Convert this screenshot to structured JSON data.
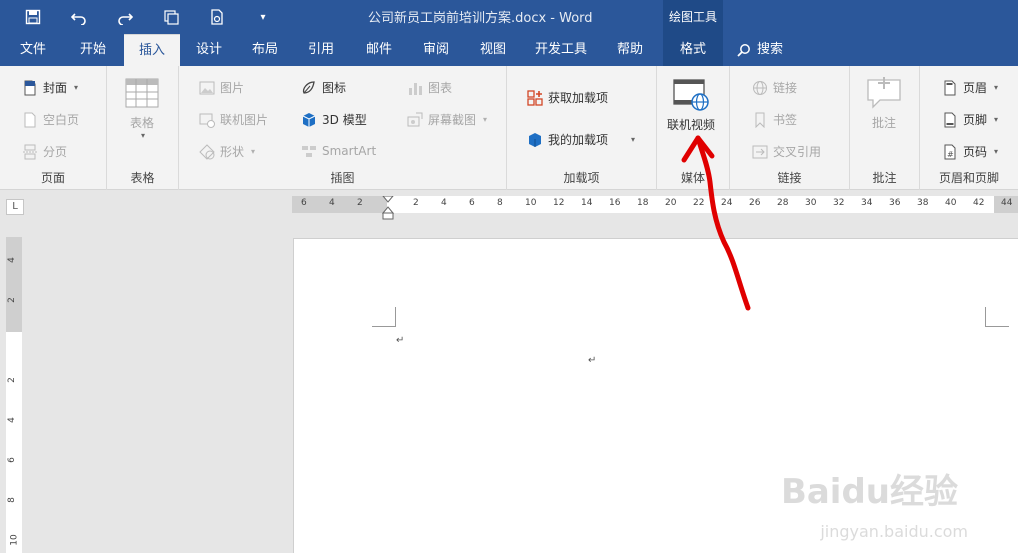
{
  "title_bar": {
    "document_title": "公司新员工岗前培训方案.docx - Word",
    "context_tab_group": "绘图工具",
    "quick_access": [
      "save-icon",
      "undo-icon",
      "redo-icon",
      "touch-mode-icon",
      "print-preview-icon",
      "customize-qat-icon"
    ]
  },
  "tabs": [
    {
      "label": "文件"
    },
    {
      "label": "开始"
    },
    {
      "label": "插入"
    },
    {
      "label": "设计"
    },
    {
      "label": "布局"
    },
    {
      "label": "引用"
    },
    {
      "label": "邮件"
    },
    {
      "label": "审阅"
    },
    {
      "label": "视图"
    },
    {
      "label": "开发工具"
    },
    {
      "label": "帮助"
    },
    {
      "label": "格式"
    }
  ],
  "search_label": "搜索",
  "groups": {
    "pages": {
      "label": "页面",
      "cover": "封面",
      "blank": "空白页",
      "break": "分页"
    },
    "tables": {
      "label": "表格",
      "table": "表格"
    },
    "illustrations": {
      "label": "插图",
      "pictures": "图片",
      "online_pictures": "联机图片",
      "shapes": "形状",
      "icons": "图标",
      "model3d": "3D 模型",
      "smartart": "SmartArt",
      "chart": "图表",
      "screenshot": "屏幕截图"
    },
    "addins": {
      "label": "加载项",
      "get_addins": "获取加载项",
      "my_addins": "我的加载项"
    },
    "media": {
      "label": "媒体",
      "online_video": "联机视频"
    },
    "links": {
      "label": "链接",
      "link": "链接",
      "bookmark": "书签",
      "cross_ref": "交叉引用"
    },
    "comments": {
      "label": "批注",
      "comment": "批注"
    },
    "header_footer": {
      "label": "页眉和页脚",
      "header": "页眉",
      "footer": "页脚",
      "page_number": "页码"
    }
  },
  "ruler": {
    "corner": "L",
    "horizontal_ticks": [
      "6",
      "4",
      "2",
      "",
      "2",
      "4",
      "6",
      "8",
      "10",
      "12",
      "14",
      "16",
      "18",
      "20",
      "22",
      "24",
      "26",
      "28",
      "30",
      "32",
      "34",
      "36",
      "38",
      "40",
      "42",
      "44"
    ],
    "vertical_ticks": [
      "4",
      "2",
      "",
      "2",
      "4",
      "6",
      "8",
      "10"
    ]
  },
  "document": {
    "paragraph_mark": "↵"
  },
  "watermark": {
    "brand": "Baidu经验",
    "url": "jingyan.baidu.com"
  },
  "colors": {
    "accent": "#2b579a",
    "annotation": "#e00000"
  }
}
